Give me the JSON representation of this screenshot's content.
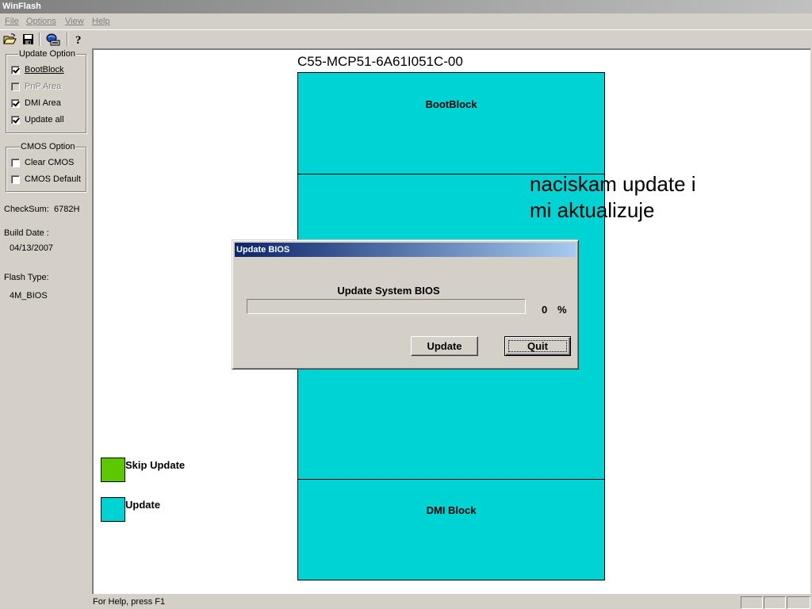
{
  "window": {
    "title": "WinFlash"
  },
  "menu": [
    {
      "label": "File"
    },
    {
      "label": "Options"
    },
    {
      "label": "View"
    },
    {
      "label": "Help"
    }
  ],
  "toolbar": {
    "icons": [
      "open-folder-icon",
      "save-icon",
      "flash-update-icon",
      "help-icon"
    ]
  },
  "update_option": {
    "legend": "Update Option",
    "items": [
      {
        "label": "BootBlock",
        "checked": true,
        "enabled": true
      },
      {
        "label": "PnP Area",
        "checked": false,
        "enabled": false
      },
      {
        "label": "DMI Area",
        "checked": true,
        "enabled": true
      },
      {
        "label": "Update all",
        "checked": true,
        "enabled": true
      }
    ]
  },
  "cmos_option": {
    "legend": "CMOS Option",
    "items": [
      {
        "label": "Clear CMOS",
        "checked": false,
        "enabled": true
      },
      {
        "label": "CMOS Default",
        "checked": false,
        "enabled": true
      }
    ]
  },
  "info": {
    "checksum_label": "CheckSum:",
    "checksum_value": "6782H",
    "build_date_label": "Build Date :",
    "build_date_value": "04/13/2007",
    "flash_type_label": "Flash Type:",
    "flash_type_value": "4M_BIOS"
  },
  "flash_map": {
    "chip_title": "C55-MCP51-6A61I051C-00",
    "blocks": [
      {
        "label": "BootBlock"
      },
      {
        "label": ""
      },
      {
        "label": "DMI Block"
      }
    ],
    "block_color": "#00d3d3"
  },
  "legend": {
    "skip_label": "Skip Update",
    "skip_color": "#5cc800",
    "update_label": "Update",
    "update_color": "#00d3d3"
  },
  "annotation": {
    "line1": "naciskam update i",
    "line2": "mi aktualizuje"
  },
  "dialog": {
    "title": "Update BIOS",
    "heading": "Update System BIOS",
    "progress_value": "0",
    "progress_unit": "%",
    "progress_fraction": 0,
    "update_button": "Update",
    "quit_button": "Quit"
  },
  "statusbar": {
    "text": "For Help, press F1"
  }
}
